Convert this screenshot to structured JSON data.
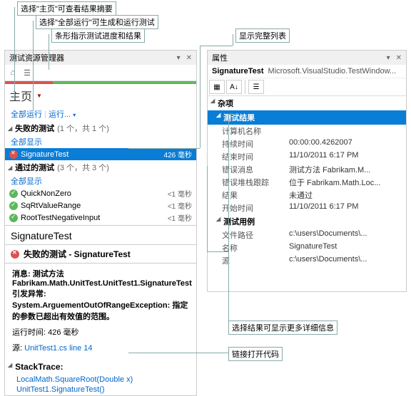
{
  "callouts": {
    "c1": "选择\"主页\"可查看结果摘要",
    "c2": "选择\"全部运行\"可生成和运行测试",
    "c3": "条形指示测试进度和结果",
    "c4": "显示完整列表",
    "c5": "选择结果可显示更多详细信息",
    "c6": "链接打开代码"
  },
  "left": {
    "title": "测试资源管理器",
    "home": "主页",
    "run_all": "全部运行",
    "run": "运行...",
    "failed_hdr": "失败的测试",
    "failed_count": "(1 个，共 1 个)",
    "show_all_1": "全部显示",
    "failed_tests": [
      {
        "name": "SignatureTest",
        "time": "426 毫秒"
      }
    ],
    "passed_hdr": "通过的测试",
    "passed_count": "(3 个，共 3 个)",
    "show_all_2": "全部显示",
    "passed_tests": [
      {
        "name": "QuickNonZero",
        "time": "<1 毫秒"
      },
      {
        "name": "SqRtValueRange",
        "time": "<1 毫秒"
      },
      {
        "name": "RootTestNegativeInput",
        "time": "<1 毫秒"
      }
    ],
    "detail": {
      "title": "SignatureTest",
      "subtitle": "失败的测试 - SignatureTest",
      "msg_label": "消息:",
      "msg_body": "测试方法 Fabrikam.Math.UnitTest.UnitTest1.SignatureTest 引发异常: System.ArguementOutOfRangeException: 指定的参数已超出有效值的范围。",
      "runtime_label": "运行时间:",
      "runtime_val": "426 毫秒",
      "src_label": "源:",
      "src_link": "UnitTest1.cs line 14",
      "stack_label": "StackTrace:",
      "stack": [
        "LocalMath.SquareRoot(Double x)",
        "UnitTest1.SignatureTest()"
      ]
    }
  },
  "right": {
    "title": "属性",
    "subject": "SignatureTest",
    "class": "Microsoft.VisualStudio.TestWindow...",
    "cat_misc": "杂项",
    "cat_result": "测试结果",
    "result_rows": [
      {
        "k": "计算机名称",
        "v": ""
      },
      {
        "k": "持续时间",
        "v": "00:00:00.4262007"
      },
      {
        "k": "结束时间",
        "v": "11/10/2011 6:17 PM"
      },
      {
        "k": "错误消息",
        "v": "测试方法 Fabrikam.M..."
      },
      {
        "k": "错误堆栈跟踪",
        "v": "   位于 Fabrikam.Math.Loc..."
      },
      {
        "k": "结果",
        "v": "未通过"
      },
      {
        "k": "开始时间",
        "v": "11/10/2011 6:17 PM"
      }
    ],
    "cat_case": "测试用例",
    "case_rows": [
      {
        "k": "文件路径",
        "v": "c:\\users\\Documents\\..."
      },
      {
        "k": "名称",
        "v": "SignatureTest"
      },
      {
        "k": "源",
        "v": "c:\\users\\Documents\\..."
      }
    ]
  }
}
